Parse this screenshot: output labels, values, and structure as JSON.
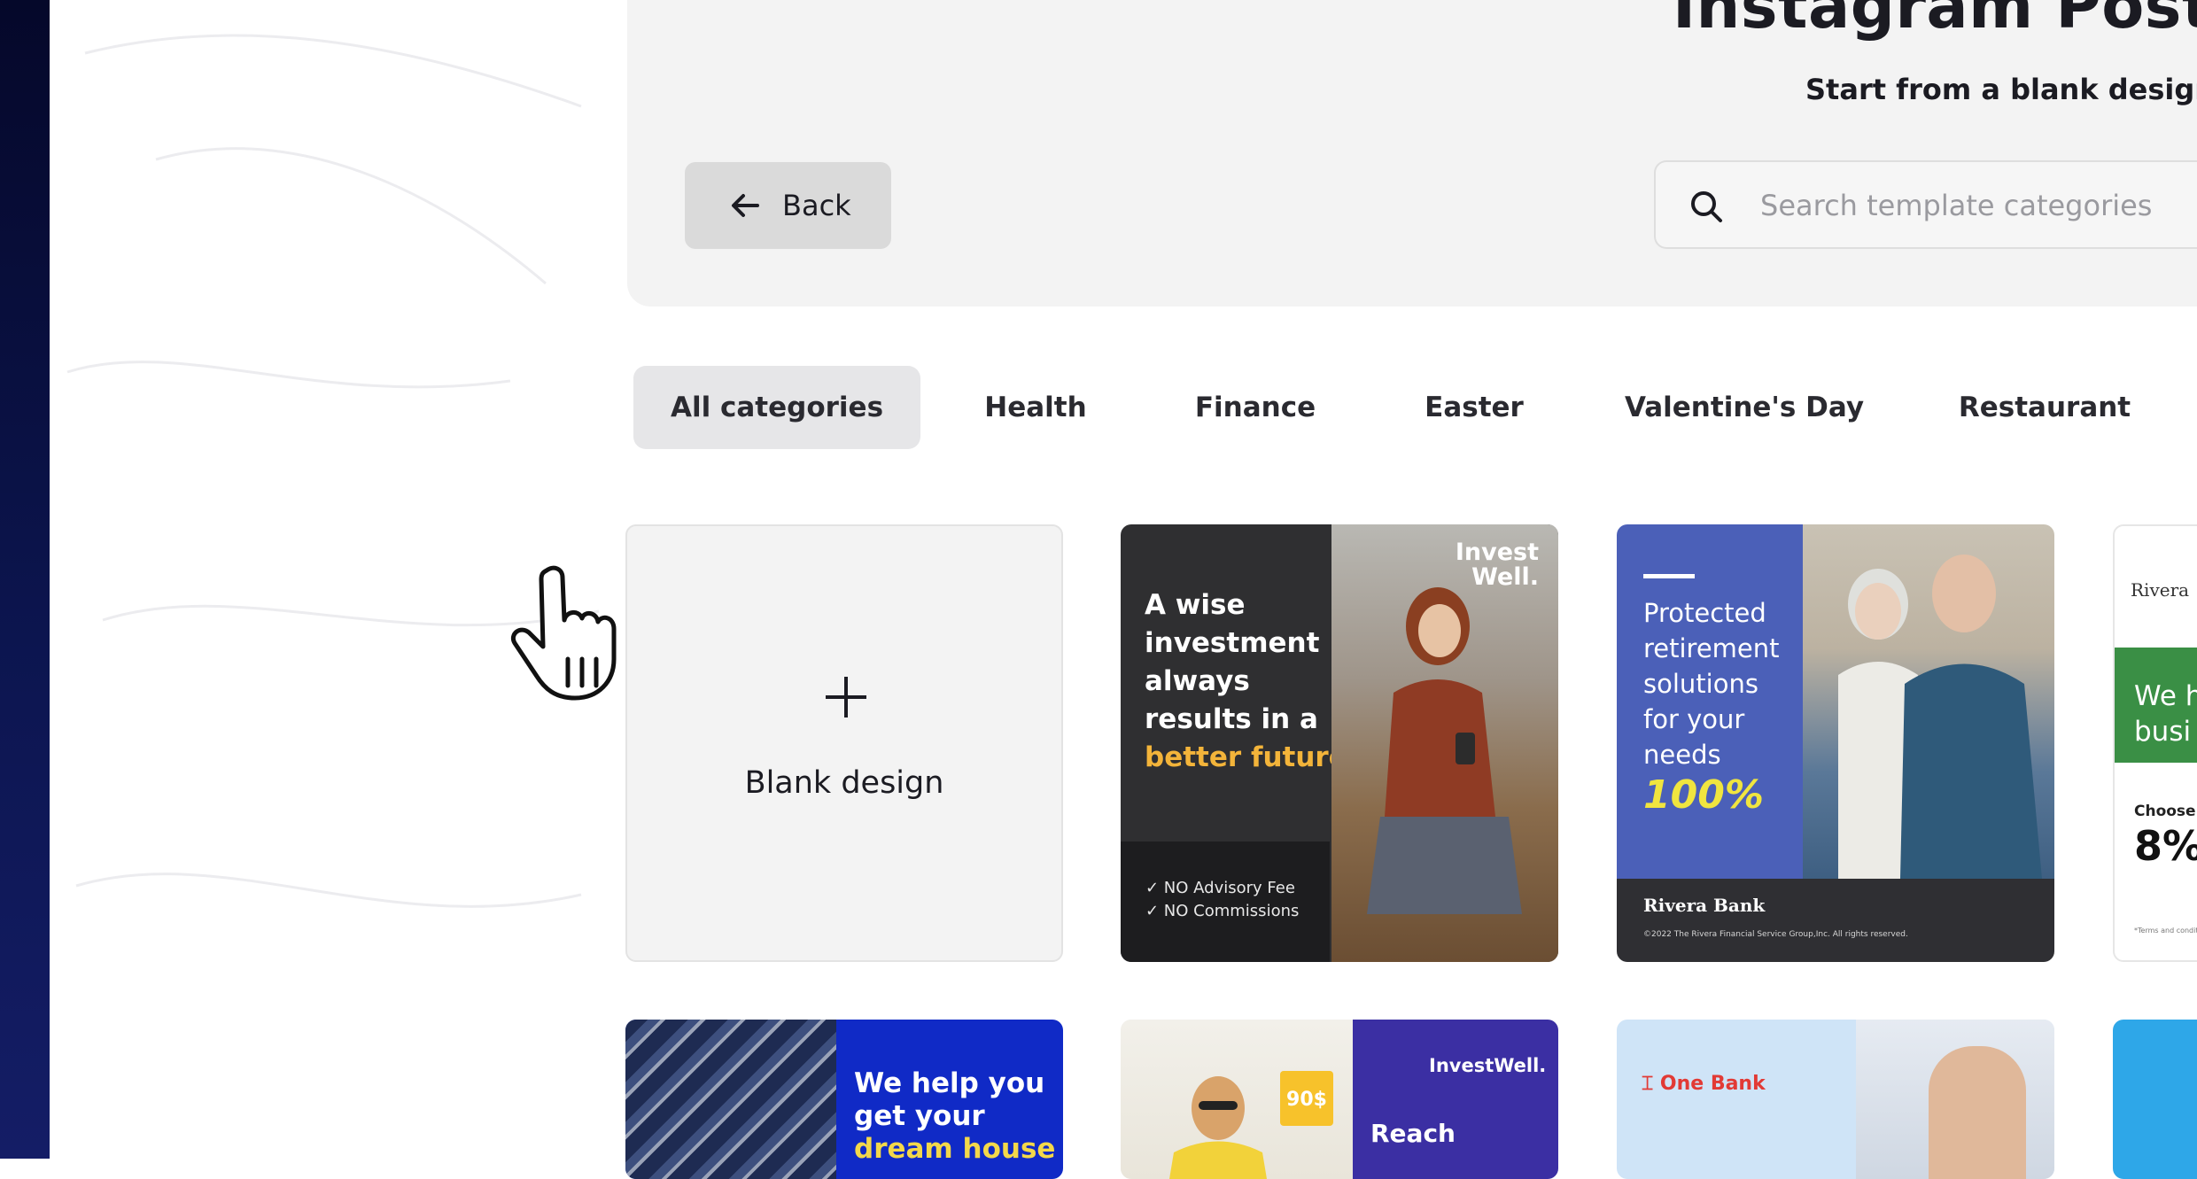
{
  "header": {
    "title": "Instagram Post",
    "subtitle": "Start from a blank design or",
    "back_label": "Back",
    "search_placeholder": "Search template categories"
  },
  "categories": [
    {
      "label": "All categories",
      "active": true
    },
    {
      "label": "Health",
      "active": false
    },
    {
      "label": "Finance",
      "active": false
    },
    {
      "label": "Easter",
      "active": false
    },
    {
      "label": "Valentine's Day",
      "active": false
    },
    {
      "label": "Restaurant",
      "active": false
    }
  ],
  "blank": {
    "label": "Blank design"
  },
  "templates": {
    "t1": {
      "line1": "A wise",
      "line2": "investment",
      "line3": "always",
      "line4": "results in a",
      "accent": "better future",
      "feature1": "✓ NO Advisory Fee",
      "feature2": "✓ NO Commissions",
      "logo_line1": "Invest",
      "logo_line2": "Well."
    },
    "t2": {
      "text": "Protected retirement solutions for your needs",
      "percent": "100%",
      "brand": "Rivera Bank",
      "fine_print": "©2022 The Rivera Financial Service Group,Inc. All rights reserved."
    },
    "t3": {
      "brand": "Rivera",
      "green_line1": "We h",
      "green_line2": "busi",
      "small": "Choose us",
      "big": "8%",
      "fine": "*Terms and condition"
    },
    "t4": {
      "line1": "We help you",
      "line2": "get your",
      "accent": "dream house"
    },
    "t5": {
      "badge": "90$",
      "logo": "InvestWell.",
      "reach": "Reach"
    },
    "t6": {
      "brand": "One Bank"
    }
  },
  "colors": {
    "accent_yellow": "#f3b43a",
    "finance_blue": "#4b60b8",
    "percent_yellow": "#f0e53f",
    "green": "#3a8f45",
    "onebank_red": "#e23a35"
  }
}
